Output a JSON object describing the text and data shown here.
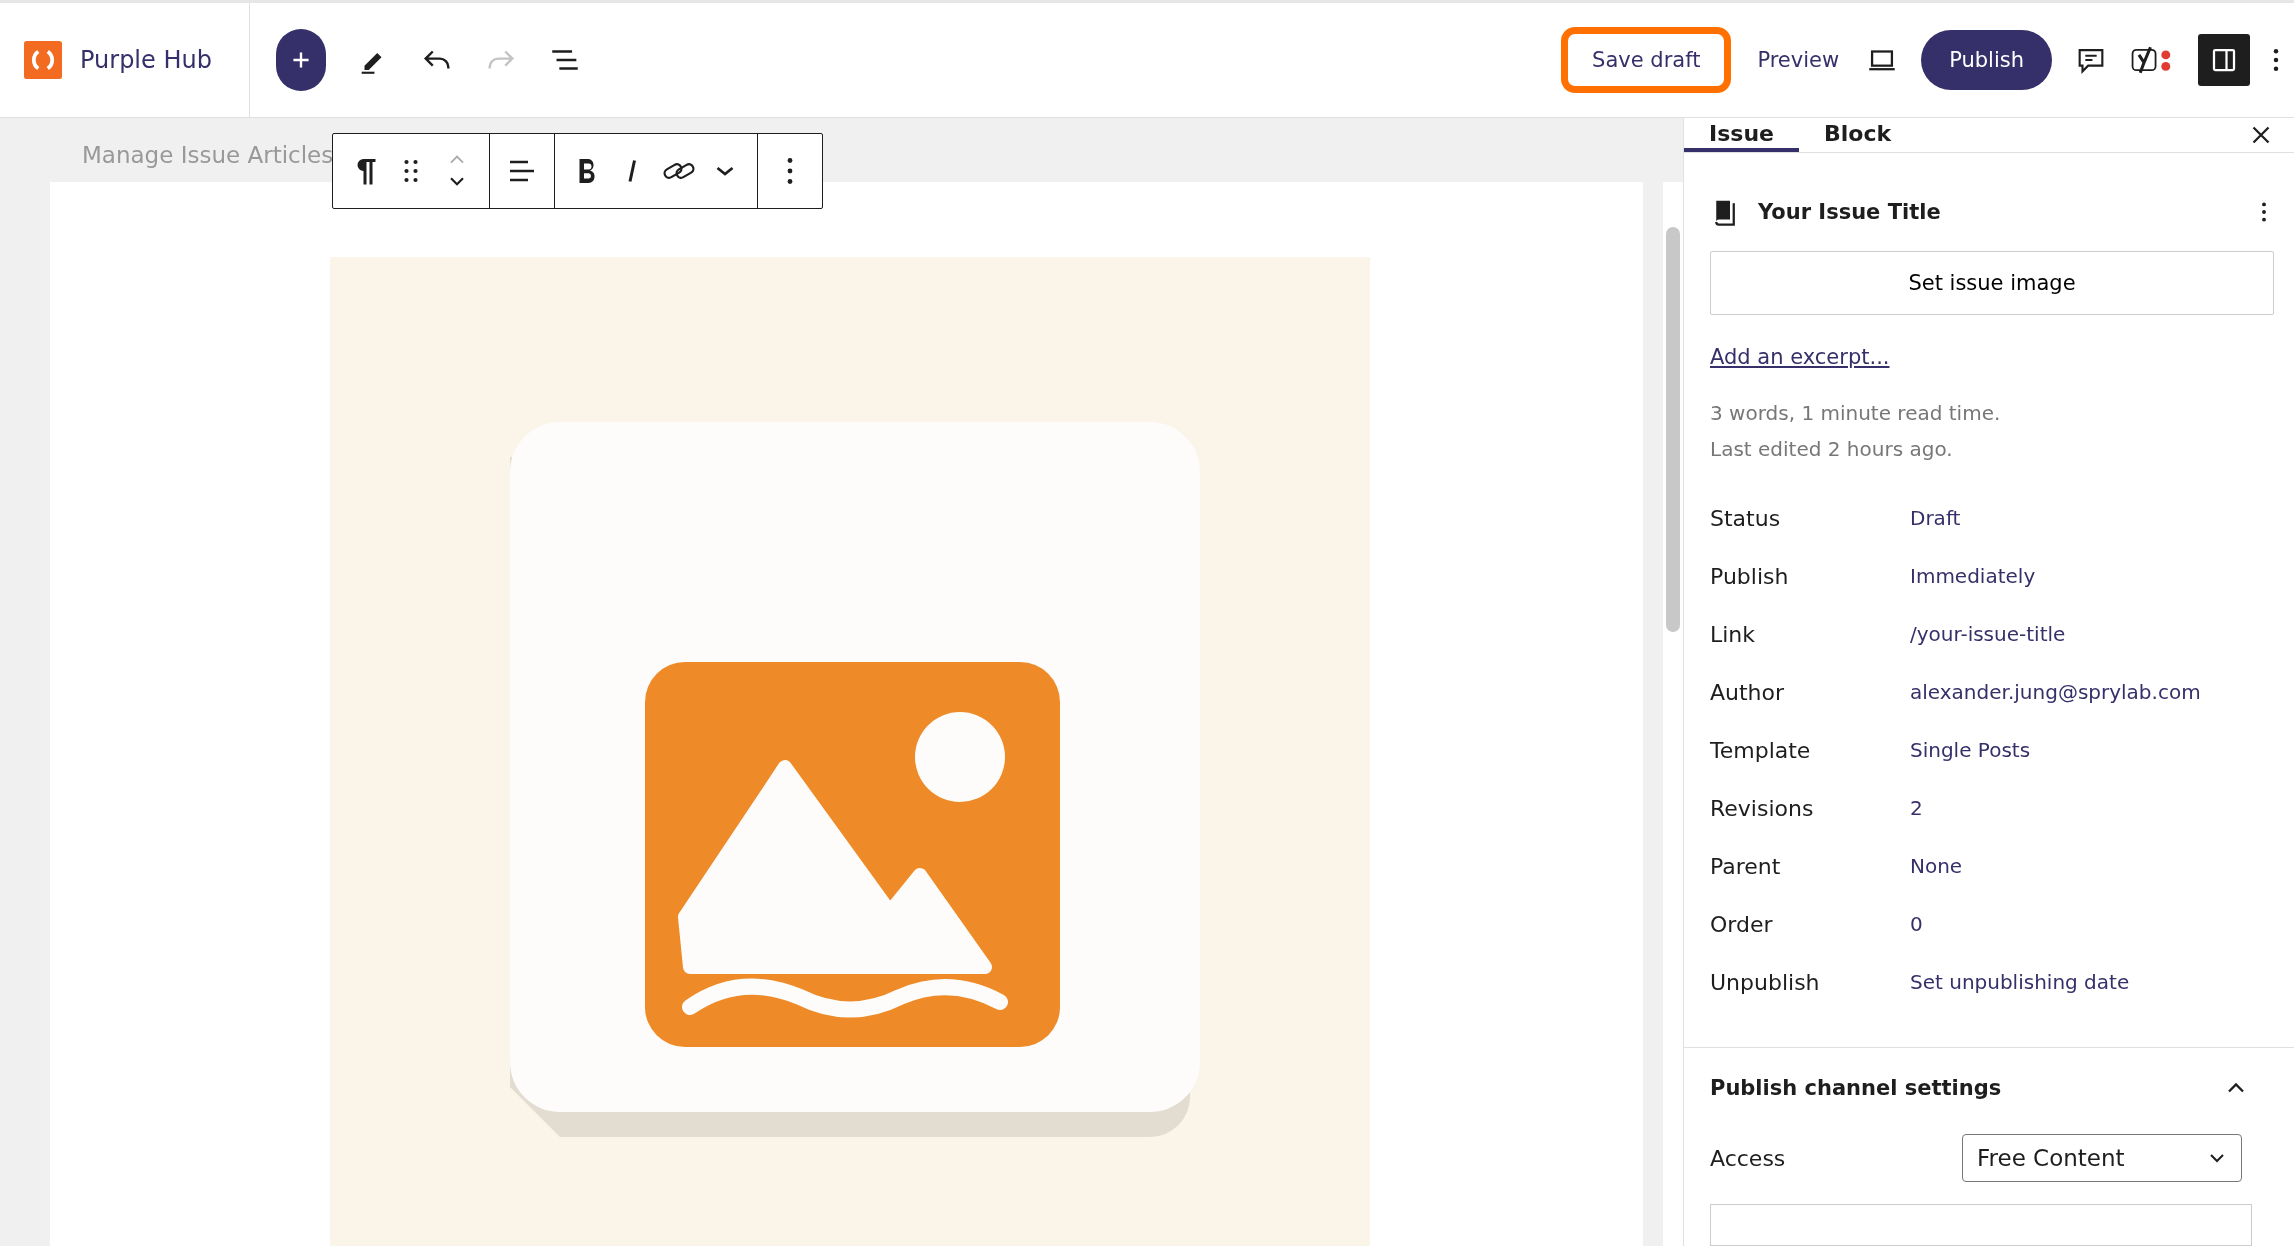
{
  "brand": {
    "name": "Purple Hub"
  },
  "toolbar": {
    "redo_disabled": true
  },
  "header_actions": {
    "save_draft": "Save draft",
    "save_draft_highlighted": true,
    "preview": "Preview",
    "publish": "Publish"
  },
  "editor_tabs": [
    {
      "label": "Manage Issue Articles"
    }
  ],
  "sidebar": {
    "tabs": [
      {
        "label": "Issue",
        "selected": true
      },
      {
        "label": "Block",
        "selected": false
      }
    ],
    "title": "Your Issue Title",
    "set_image_button": "Set issue image",
    "excerpt_link": "Add an excerpt...",
    "stats": [
      "3 words, 1 minute read time.",
      "Last edited 2 hours ago."
    ],
    "fields": [
      {
        "label": "Status",
        "value": "Draft"
      },
      {
        "label": "Publish",
        "value": "Immediately"
      },
      {
        "label": "Link",
        "value": "/your-issue-title"
      },
      {
        "label": "Author",
        "value": "alexander.jung@sprylab.com"
      },
      {
        "label": "Template",
        "value": "Single Posts"
      },
      {
        "label": "Revisions",
        "value": "2"
      },
      {
        "label": "Parent",
        "value": "None"
      },
      {
        "label": "Order",
        "value": "0"
      },
      {
        "label": "Unpublish",
        "value": "Set unpublishing date"
      }
    ],
    "panel": {
      "title": "Publish channel settings",
      "expanded": true,
      "access": {
        "label": "Access",
        "value": "Free Content"
      }
    }
  }
}
